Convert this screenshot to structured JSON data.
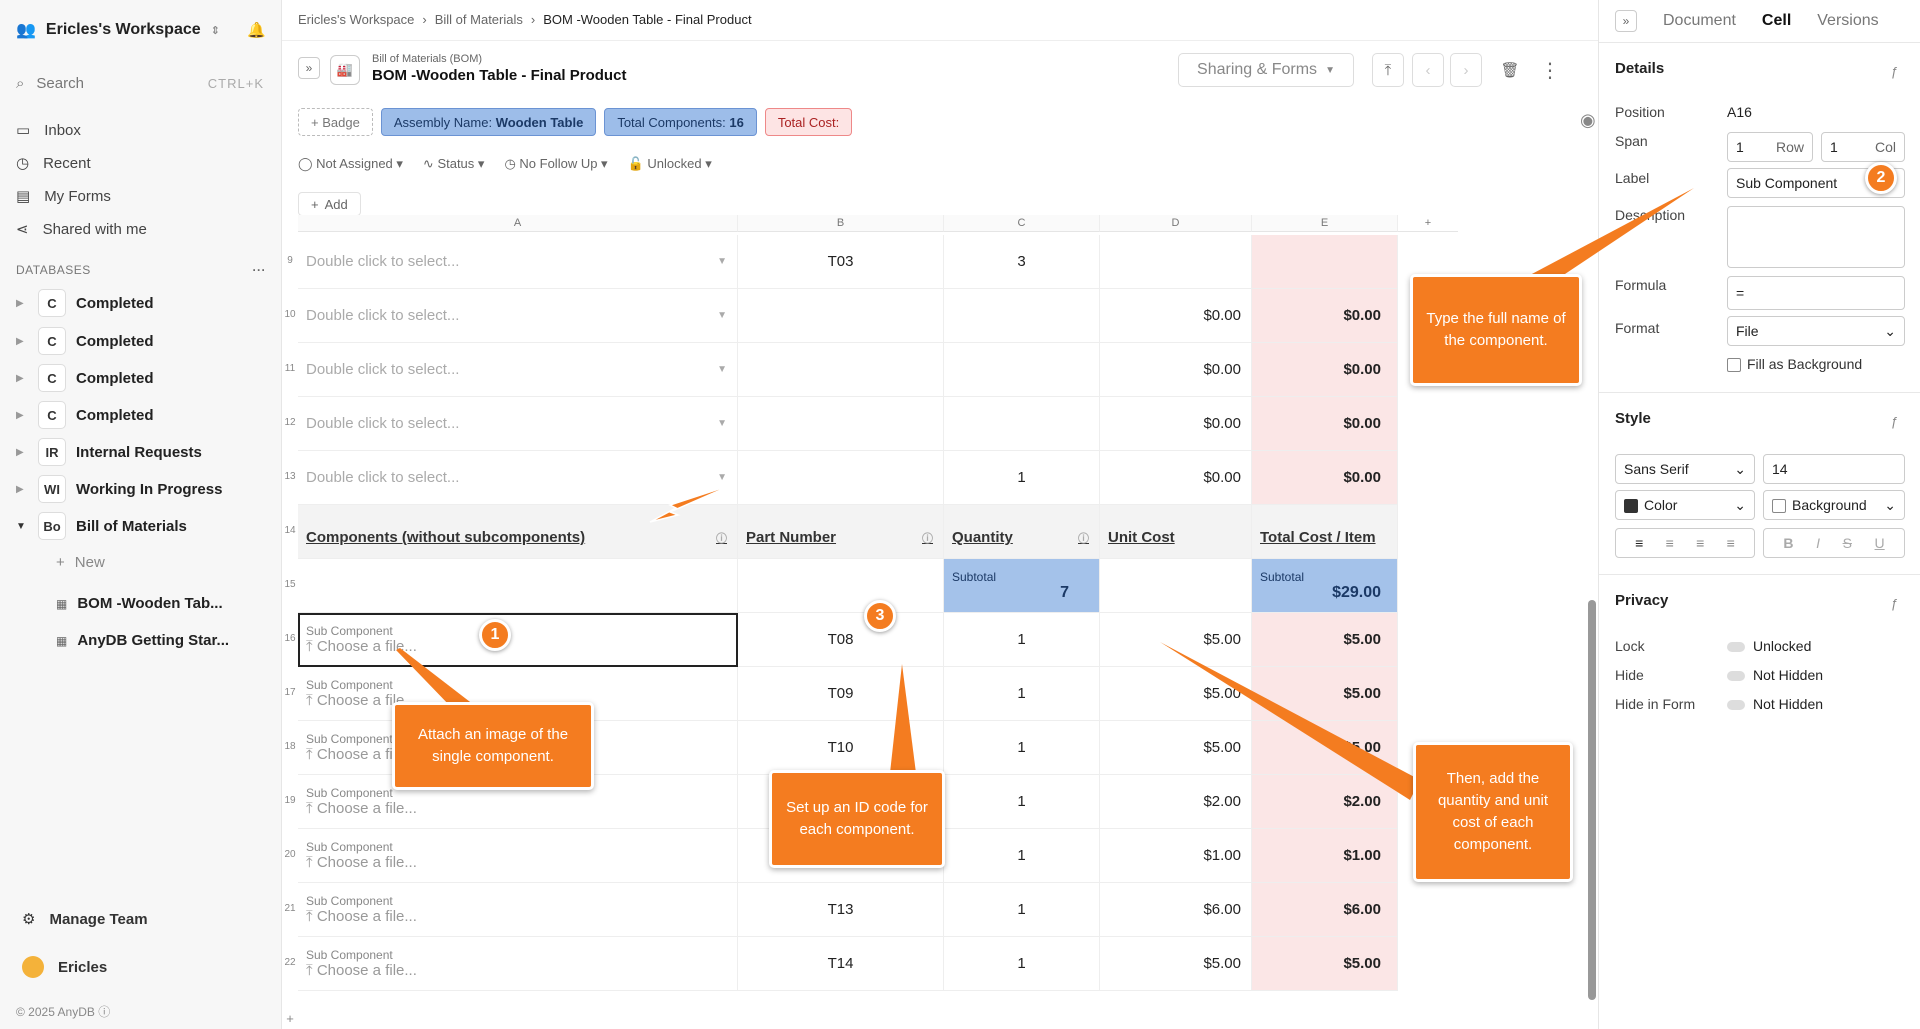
{
  "sidebar": {
    "workspace": "Ericles's Workspace",
    "search_placeholder": "Search",
    "search_shortcut": "CTRL+K",
    "nav": [
      "Inbox",
      "Recent",
      "My Forms",
      "Shared with me"
    ],
    "databases_label": "DATABASES",
    "databases": [
      {
        "abbr": "C",
        "name": "Completed"
      },
      {
        "abbr": "C",
        "name": "Completed"
      },
      {
        "abbr": "C",
        "name": "Completed"
      },
      {
        "abbr": "C",
        "name": "Completed"
      },
      {
        "abbr": "IR",
        "name": "Internal Requests"
      },
      {
        "abbr": "WI",
        "name": "Working In Progress"
      },
      {
        "abbr": "Bo",
        "name": "Bill of Materials"
      }
    ],
    "new_label": "New",
    "docs": [
      "BOM -Wooden Tab...",
      "AnyDB Getting Star..."
    ],
    "manage_team": "Manage Team",
    "user": "Ericles",
    "copyright": "© 2025 AnyDB"
  },
  "header": {
    "breadcrumb": [
      "Ericles's Workspace",
      "Bill of Materials",
      "BOM -Wooden Table - Final Product"
    ],
    "doc_type": "Bill of Materials (BOM)",
    "doc_title": "BOM -Wooden Table - Final Product",
    "sharing": "Sharing & Forms"
  },
  "badges": {
    "add": "Badge",
    "assembly_prefix": "Assembly Name:",
    "assembly_value": "Wooden Table",
    "components_prefix": "Total Components:",
    "components_value": "16",
    "cost_label": "Total Cost:"
  },
  "meta": {
    "assigned": "Not Assigned",
    "status": "Status",
    "follow": "No Follow Up",
    "lock": "Unlocked",
    "add": "Add"
  },
  "grid": {
    "columns": [
      "A",
      "B",
      "C",
      "D",
      "E"
    ],
    "placeholder": "Double click to select...",
    "rows_top": [
      {
        "n": "9",
        "b": "T03",
        "c": "3",
        "d": "",
        "e": ""
      },
      {
        "n": "10",
        "b": "",
        "c": "",
        "d": "$0.00",
        "e": "$0.00"
      },
      {
        "n": "11",
        "b": "",
        "c": "",
        "d": "$0.00",
        "e": "$0.00"
      },
      {
        "n": "12",
        "b": "",
        "c": "",
        "d": "$0.00",
        "e": "$0.00"
      },
      {
        "n": "13",
        "b": "",
        "c": "1",
        "d": "$0.00",
        "e": "$0.00"
      }
    ],
    "header_row": {
      "n": "14",
      "a": "Components (without subcomponents)",
      "b": "Part Number",
      "c": "Quantity",
      "d": "Unit Cost",
      "e": "Total Cost / Item"
    },
    "subtotal_row": {
      "n": "15",
      "label": "Subtotal",
      "qty": "7",
      "cost": "$29.00"
    },
    "sub_label": "Sub Component",
    "file_label": "Choose a file...",
    "rows_sub": [
      {
        "n": "16",
        "b": "T08",
        "c": "1",
        "d": "$5.00",
        "e": "$5.00"
      },
      {
        "n": "17",
        "b": "T09",
        "c": "1",
        "d": "$5.00",
        "e": "$5.00"
      },
      {
        "n": "18",
        "b": "T10",
        "c": "1",
        "d": "$5.00",
        "e": "$5.00"
      },
      {
        "n": "19",
        "b": "",
        "c": "1",
        "d": "$2.00",
        "e": "$2.00"
      },
      {
        "n": "20",
        "b": "",
        "c": "1",
        "d": "$1.00",
        "e": "$1.00"
      },
      {
        "n": "21",
        "b": "T13",
        "c": "1",
        "d": "$6.00",
        "e": "$6.00"
      },
      {
        "n": "22",
        "b": "T14",
        "c": "1",
        "d": "$5.00",
        "e": "$5.00"
      }
    ]
  },
  "panel": {
    "tabs": [
      "Document",
      "Cell",
      "Versions"
    ],
    "details": "Details",
    "position_label": "Position",
    "position_value": "A16",
    "span_label": "Span",
    "span_row": "1",
    "row_word": "Row",
    "span_col": "1",
    "col_word": "Col",
    "label_label": "Label",
    "label_value": "Sub Component",
    "description_label": "Description",
    "formula_label": "Formula",
    "formula_value": "=",
    "format_label": "Format",
    "format_value": "File",
    "fill_bg": "Fill as Background",
    "style": "Style",
    "font": "Sans Serif",
    "font_size": "14",
    "color": "Color",
    "background": "Background",
    "privacy": "Privacy",
    "lock_label": "Lock",
    "lock_value": "Unlocked",
    "hide_label": "Hide",
    "hide_value": "Not Hidden",
    "hideform_label": "Hide in Form",
    "hideform_value": "Not Hidden"
  },
  "callouts": {
    "c1": "Attach an image of the single component.",
    "c2": "Type the full name of the component.",
    "c3": "Set up an ID code for each component.",
    "c4": "Then, add the quantity and unit cost of each component.",
    "m1": "1",
    "m2": "2",
    "m3": "3"
  }
}
